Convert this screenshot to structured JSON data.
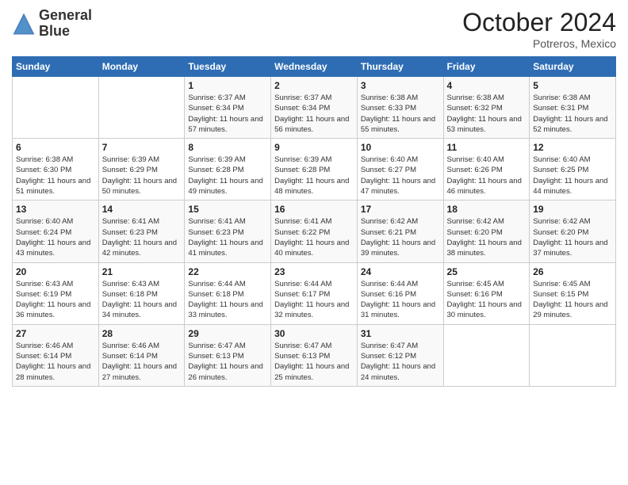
{
  "header": {
    "logo_line1": "General",
    "logo_line2": "Blue",
    "month": "October 2024",
    "location": "Potreros, Mexico"
  },
  "weekdays": [
    "Sunday",
    "Monday",
    "Tuesday",
    "Wednesday",
    "Thursday",
    "Friday",
    "Saturday"
  ],
  "weeks": [
    [
      {
        "day": "",
        "detail": ""
      },
      {
        "day": "",
        "detail": ""
      },
      {
        "day": "1",
        "detail": "Sunrise: 6:37 AM\nSunset: 6:34 PM\nDaylight: 11 hours and 57 minutes."
      },
      {
        "day": "2",
        "detail": "Sunrise: 6:37 AM\nSunset: 6:34 PM\nDaylight: 11 hours and 56 minutes."
      },
      {
        "day": "3",
        "detail": "Sunrise: 6:38 AM\nSunset: 6:33 PM\nDaylight: 11 hours and 55 minutes."
      },
      {
        "day": "4",
        "detail": "Sunrise: 6:38 AM\nSunset: 6:32 PM\nDaylight: 11 hours and 53 minutes."
      },
      {
        "day": "5",
        "detail": "Sunrise: 6:38 AM\nSunset: 6:31 PM\nDaylight: 11 hours and 52 minutes."
      }
    ],
    [
      {
        "day": "6",
        "detail": "Sunrise: 6:38 AM\nSunset: 6:30 PM\nDaylight: 11 hours and 51 minutes."
      },
      {
        "day": "7",
        "detail": "Sunrise: 6:39 AM\nSunset: 6:29 PM\nDaylight: 11 hours and 50 minutes."
      },
      {
        "day": "8",
        "detail": "Sunrise: 6:39 AM\nSunset: 6:28 PM\nDaylight: 11 hours and 49 minutes."
      },
      {
        "day": "9",
        "detail": "Sunrise: 6:39 AM\nSunset: 6:28 PM\nDaylight: 11 hours and 48 minutes."
      },
      {
        "day": "10",
        "detail": "Sunrise: 6:40 AM\nSunset: 6:27 PM\nDaylight: 11 hours and 47 minutes."
      },
      {
        "day": "11",
        "detail": "Sunrise: 6:40 AM\nSunset: 6:26 PM\nDaylight: 11 hours and 46 minutes."
      },
      {
        "day": "12",
        "detail": "Sunrise: 6:40 AM\nSunset: 6:25 PM\nDaylight: 11 hours and 44 minutes."
      }
    ],
    [
      {
        "day": "13",
        "detail": "Sunrise: 6:40 AM\nSunset: 6:24 PM\nDaylight: 11 hours and 43 minutes."
      },
      {
        "day": "14",
        "detail": "Sunrise: 6:41 AM\nSunset: 6:23 PM\nDaylight: 11 hours and 42 minutes."
      },
      {
        "day": "15",
        "detail": "Sunrise: 6:41 AM\nSunset: 6:23 PM\nDaylight: 11 hours and 41 minutes."
      },
      {
        "day": "16",
        "detail": "Sunrise: 6:41 AM\nSunset: 6:22 PM\nDaylight: 11 hours and 40 minutes."
      },
      {
        "day": "17",
        "detail": "Sunrise: 6:42 AM\nSunset: 6:21 PM\nDaylight: 11 hours and 39 minutes."
      },
      {
        "day": "18",
        "detail": "Sunrise: 6:42 AM\nSunset: 6:20 PM\nDaylight: 11 hours and 38 minutes."
      },
      {
        "day": "19",
        "detail": "Sunrise: 6:42 AM\nSunset: 6:20 PM\nDaylight: 11 hours and 37 minutes."
      }
    ],
    [
      {
        "day": "20",
        "detail": "Sunrise: 6:43 AM\nSunset: 6:19 PM\nDaylight: 11 hours and 36 minutes."
      },
      {
        "day": "21",
        "detail": "Sunrise: 6:43 AM\nSunset: 6:18 PM\nDaylight: 11 hours and 34 minutes."
      },
      {
        "day": "22",
        "detail": "Sunrise: 6:44 AM\nSunset: 6:18 PM\nDaylight: 11 hours and 33 minutes."
      },
      {
        "day": "23",
        "detail": "Sunrise: 6:44 AM\nSunset: 6:17 PM\nDaylight: 11 hours and 32 minutes."
      },
      {
        "day": "24",
        "detail": "Sunrise: 6:44 AM\nSunset: 6:16 PM\nDaylight: 11 hours and 31 minutes."
      },
      {
        "day": "25",
        "detail": "Sunrise: 6:45 AM\nSunset: 6:16 PM\nDaylight: 11 hours and 30 minutes."
      },
      {
        "day": "26",
        "detail": "Sunrise: 6:45 AM\nSunset: 6:15 PM\nDaylight: 11 hours and 29 minutes."
      }
    ],
    [
      {
        "day": "27",
        "detail": "Sunrise: 6:46 AM\nSunset: 6:14 PM\nDaylight: 11 hours and 28 minutes."
      },
      {
        "day": "28",
        "detail": "Sunrise: 6:46 AM\nSunset: 6:14 PM\nDaylight: 11 hours and 27 minutes."
      },
      {
        "day": "29",
        "detail": "Sunrise: 6:47 AM\nSunset: 6:13 PM\nDaylight: 11 hours and 26 minutes."
      },
      {
        "day": "30",
        "detail": "Sunrise: 6:47 AM\nSunset: 6:13 PM\nDaylight: 11 hours and 25 minutes."
      },
      {
        "day": "31",
        "detail": "Sunrise: 6:47 AM\nSunset: 6:12 PM\nDaylight: 11 hours and 24 minutes."
      },
      {
        "day": "",
        "detail": ""
      },
      {
        "day": "",
        "detail": ""
      }
    ]
  ]
}
